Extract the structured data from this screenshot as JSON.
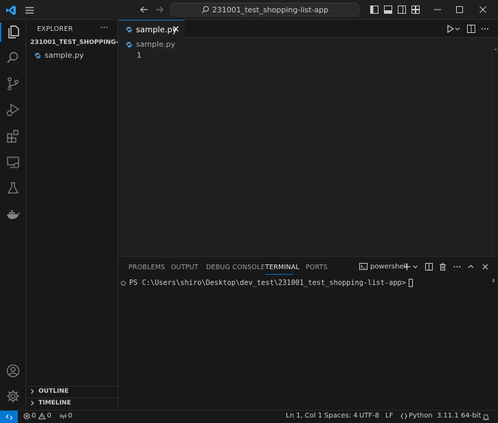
{
  "titlebar": {
    "search_text": "231001_test_shopping-list-app"
  },
  "sidebar": {
    "title": "EXPLORER",
    "more": "···",
    "folder_name": "231001_TEST_SHOPPING-L...",
    "files": [
      {
        "name": "sample.py"
      }
    ],
    "outline_label": "OUTLINE",
    "timeline_label": "TIMELINE"
  },
  "editor": {
    "tab_label": "sample.py",
    "breadcrumb": "sample.py",
    "line_numbers": [
      "1"
    ]
  },
  "panel": {
    "tabs": [
      "PROBLEMS",
      "OUTPUT",
      "DEBUG CONSOLE",
      "TERMINAL",
      "PORTS"
    ],
    "active_tab": "TERMINAL",
    "shell_label": "powershell",
    "terminal_prompt": "PS C:\\Users\\shiro\\Desktop\\dev_test\\231001_test_shopping-list-app>"
  },
  "statusbar": {
    "errors": "0",
    "warnings": "0",
    "ports": "0",
    "position": "Ln 1, Col 1",
    "spaces": "Spaces: 4",
    "encoding": "UTF-8",
    "eol": "LF",
    "language": "Python",
    "interpreter": "3.11.1 64-bit"
  },
  "colors": {
    "accent": "#0078d4",
    "background": "#1f1f1f",
    "sidebar_bg": "#181818",
    "python_icon": "#4b8bbe"
  }
}
